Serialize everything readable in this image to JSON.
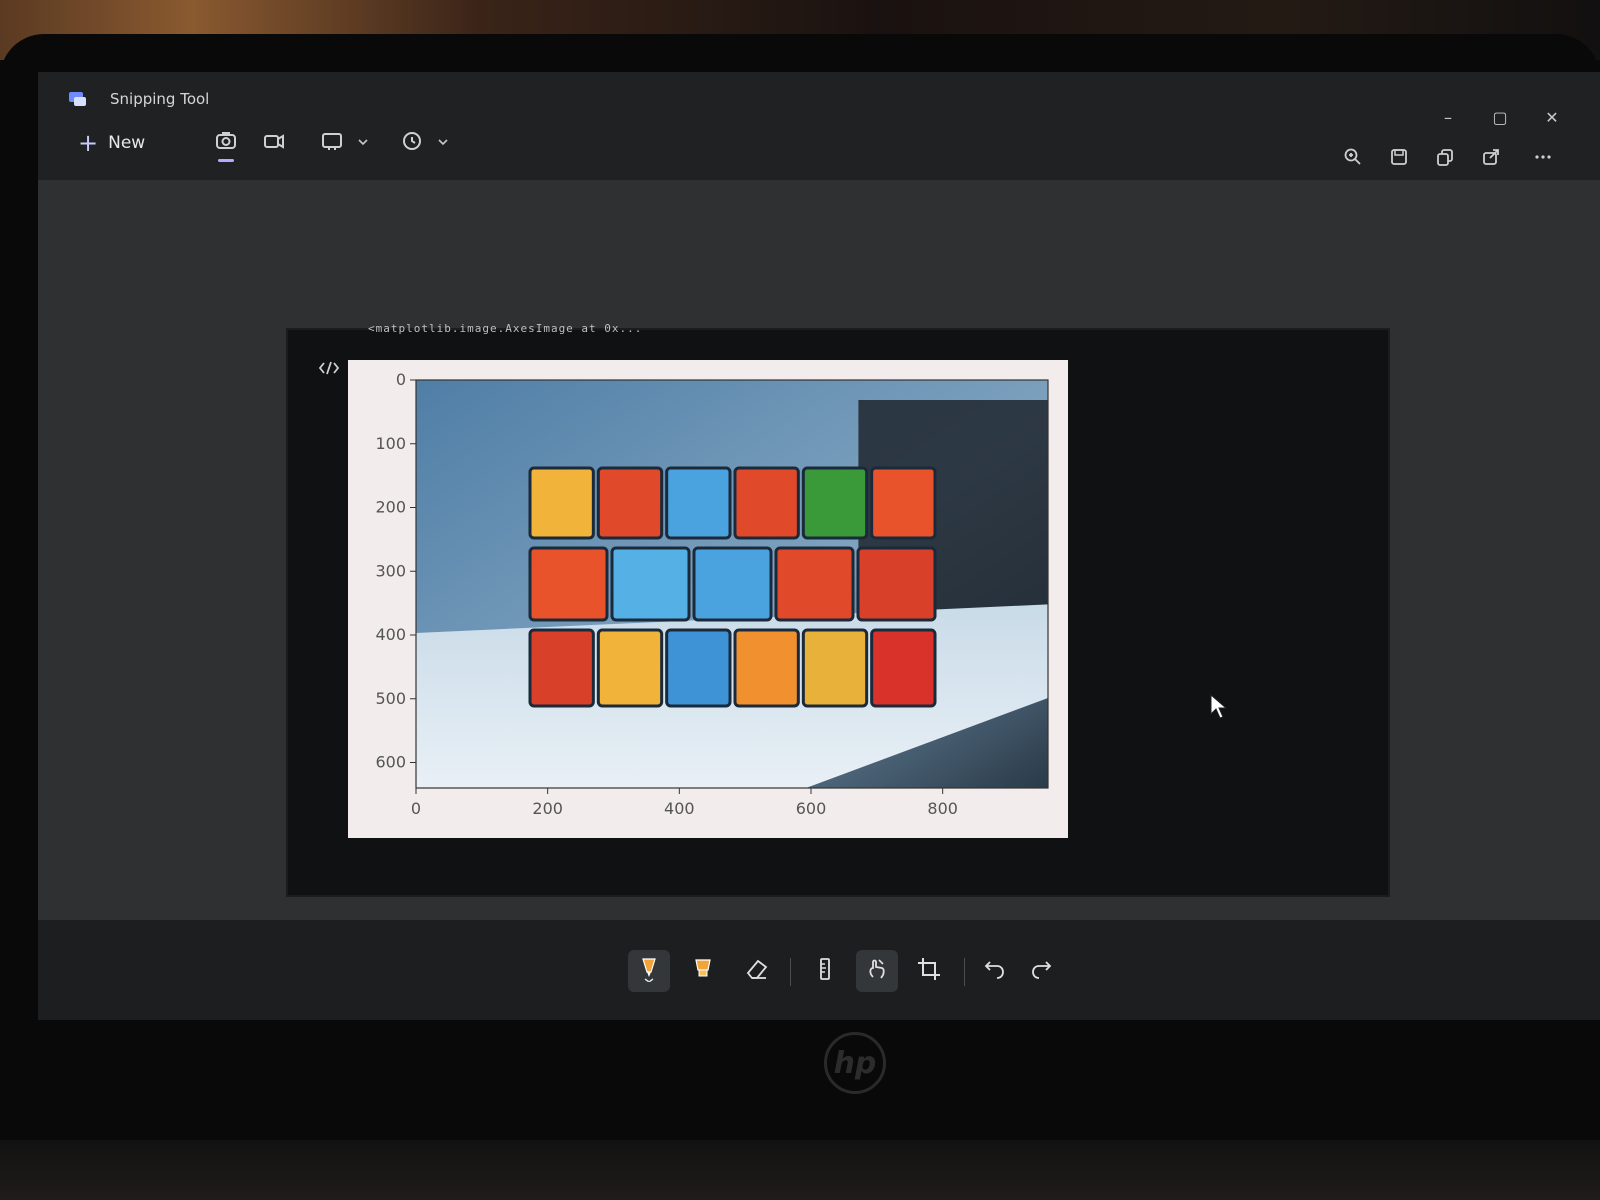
{
  "app": {
    "title": "Snipping Tool",
    "new_label": "New"
  },
  "toolbar_top": {
    "tools": [
      "camera-icon",
      "video-icon",
      "rectangle-mode-icon",
      "timer-icon"
    ],
    "right_tools": [
      "zoom-icon",
      "save-icon",
      "copy-icon",
      "share-icon",
      "more-icon"
    ]
  },
  "window_controls": {
    "minimize": "–",
    "maximize": "▢",
    "close": "✕"
  },
  "snip": {
    "cutoff_output_text": "<matplotlib.image.AxesImage at 0x..."
  },
  "chart_data": {
    "type": "image",
    "x_ticks": [
      "0",
      "200",
      "400",
      "600",
      "800"
    ],
    "y_ticks": [
      "0",
      "100",
      "200",
      "300",
      "400",
      "500",
      "600"
    ],
    "xlim": [
      0,
      960
    ],
    "ylim": [
      640,
      0
    ]
  },
  "bottom_toolbar": {
    "tools": [
      "ballpoint-pen-icon",
      "highlighter-icon",
      "eraser-icon",
      "ruler-icon",
      "touch-writing-icon",
      "crop-icon",
      "undo-icon",
      "redo-icon"
    ]
  },
  "device": {
    "logo_text": "hp"
  },
  "colors": {
    "accent": "#b9a8ff",
    "pen": "#f2a33a"
  }
}
